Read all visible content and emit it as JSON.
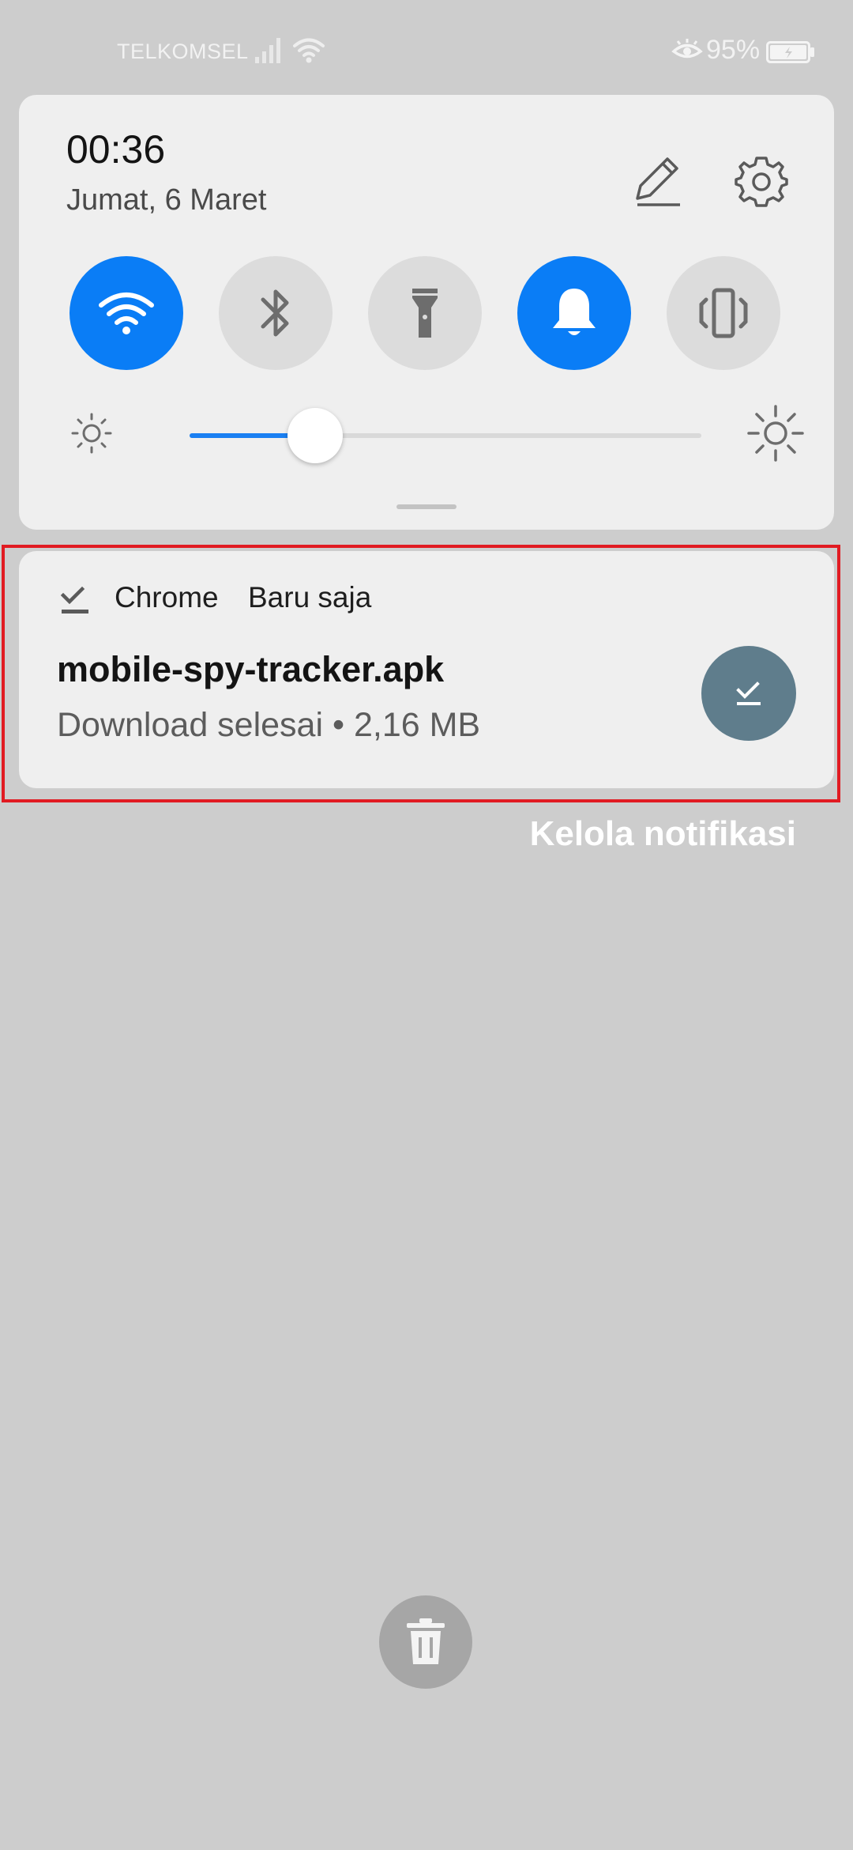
{
  "status_bar": {
    "carrier": "TELKOMSEL",
    "battery_percent": "95%",
    "icons": [
      "signal-icon",
      "wifi-icon",
      "eye-comfort-icon",
      "battery-charging-icon"
    ]
  },
  "quick_settings": {
    "time": "00:36",
    "date": "Jumat, 6 Maret",
    "actions": [
      "edit-icon",
      "settings-icon"
    ],
    "toggles": [
      {
        "name": "wifi",
        "icon": "wifi-icon",
        "on": true
      },
      {
        "name": "bluetooth",
        "icon": "bluetooth-icon",
        "on": false
      },
      {
        "name": "flashlight",
        "icon": "flashlight-icon",
        "on": false
      },
      {
        "name": "sound",
        "icon": "bell-icon",
        "on": true
      },
      {
        "name": "vibrate",
        "icon": "vibrate-icon",
        "on": false
      }
    ],
    "brightness_level": 0.245,
    "accent_color": "#0a7df6"
  },
  "notification": {
    "app_name": "Chrome",
    "time": "Baru saja",
    "title": "mobile-spy-tracker.apk",
    "body": "Download selesai • 2,16 MB",
    "app_icon": "download-done-icon",
    "action_icon": "download-done-icon",
    "highlight_color": "#e11b22"
  },
  "manage_notifications_label": "Kelola notifikasi",
  "clear_all_icon": "trash-icon"
}
